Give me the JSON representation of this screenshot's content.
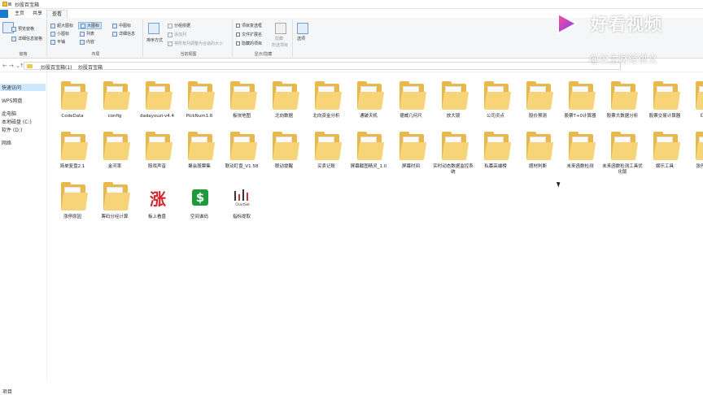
{
  "window": {
    "title": "炒股百宝箱"
  },
  "tabs": {
    "file": "",
    "home": "主页",
    "share": "共享",
    "view": "查看"
  },
  "ribbon": {
    "pane_group": {
      "nav_pane": "",
      "preview_pane": "预览窗格",
      "details_pane": "详细信息窗格",
      "label": "窗格"
    },
    "layout_group": {
      "items": [
        "超大图标",
        "大图标",
        "中图标",
        "小图标",
        "列表",
        "详细信息",
        "平铺",
        "内容"
      ],
      "label": "布局"
    },
    "view_group": {
      "sort": "排序方式",
      "group_by": "分组依据",
      "add_column": "添加列",
      "fit_columns": "将所有列调整为合适的大小",
      "label": "当前视图"
    },
    "showhide_group": {
      "item_checkboxes": "项目复选框",
      "file_extensions": "文件扩展名",
      "hidden_items": "隐藏的项目",
      "hide_selected": "隐藏",
      "hide_selected2": "所选项目",
      "label": "显示/隐藏"
    },
    "options": "选项"
  },
  "address": {
    "crumbs": [
      "炒股百宝箱(1)",
      "炒股百宝箱"
    ],
    "nav_back": "←",
    "nav_forward": "→",
    "nav_recent": "⌄",
    "nav_up": "↑"
  },
  "sidebar": {
    "items": [
      "快速访问",
      "WPS网盘",
      "此电脑",
      "本地磁盘 (C:)",
      "软件 (D:)",
      "网络"
    ]
  },
  "files": [
    {
      "name": "CodeData",
      "kind": "folder",
      "mark": ""
    },
    {
      "name": "config",
      "kind": "folder",
      "mark": ""
    },
    {
      "name": "dadayouzi-v4.4",
      "kind": "folder",
      "mark": "dark"
    },
    {
      "name": "PickNum1.6",
      "kind": "folder",
      "mark": "gray"
    },
    {
      "name": "板块地图",
      "kind": "folder",
      "mark": "gray"
    },
    {
      "name": "北向数据",
      "kind": "folder",
      "mark": ""
    },
    {
      "name": "北向资金分析",
      "kind": "folder",
      "mark": "gray"
    },
    {
      "name": "通破天机",
      "kind": "folder",
      "mark": "gray"
    },
    {
      "name": "德威几何尺",
      "kind": "folder",
      "mark": "gray"
    },
    {
      "name": "放大镜",
      "kind": "folder",
      "mark": "pink"
    },
    {
      "name": "公司灵点",
      "kind": "folder",
      "mark": "gray"
    },
    {
      "name": "股价预测",
      "kind": "folder",
      "mark": "red"
    },
    {
      "name": "股票T+0计算器",
      "kind": "folder",
      "mark": "blue"
    },
    {
      "name": "股票大数据分析",
      "kind": "folder",
      "mark": "teal"
    },
    {
      "name": "股票交易计算器",
      "kind": "folder",
      "mark": "gray"
    },
    {
      "name": "红绿数",
      "kind": "folder",
      "mark": "blue"
    },
    {
      "name": "简单复盘2.1",
      "kind": "folder",
      "mark": "gray"
    },
    {
      "name": "金河率",
      "kind": "folder",
      "mark": "gray"
    },
    {
      "name": "股戏声音",
      "kind": "folder",
      "mark": "teal"
    },
    {
      "name": "聚会股票集",
      "kind": "folder",
      "mark": "gray"
    },
    {
      "name": "联动盯盘_V1.58",
      "kind": "folder",
      "mark": "gray"
    },
    {
      "name": "联动提醒",
      "kind": "folder",
      "mark": "dark"
    },
    {
      "name": "买卖记账",
      "kind": "folder",
      "mark": "red"
    },
    {
      "name": "屏幕截图精灵_1.0",
      "kind": "folder",
      "mark": "blue"
    },
    {
      "name": "屏幕时间",
      "kind": "folder",
      "mark": "red"
    },
    {
      "name": "实时动态数据监控系统",
      "kind": "folder",
      "mark": "red"
    },
    {
      "name": "私募高端榜",
      "kind": "folder",
      "mark": "red"
    },
    {
      "name": "题材判断",
      "kind": "folder",
      "mark": "blue"
    },
    {
      "name": "未来函数检测",
      "kind": "folder",
      "mark": "gray"
    },
    {
      "name": "未来函数检测工具优化版",
      "kind": "folder",
      "mark": "gray"
    },
    {
      "name": "娱乐工具",
      "kind": "folder",
      "mark": "gray"
    },
    {
      "name": "张停辅助工",
      "kind": "folder",
      "mark": "blue"
    },
    {
      "name": "涨停原因",
      "kind": "folder",
      "mark": "gray"
    },
    {
      "name": "筹码分经计算",
      "kind": "folder",
      "mark": "gray"
    },
    {
      "name": "板上看盘",
      "kind": "app",
      "mark": "zhang"
    },
    {
      "name": "空间谁码",
      "kind": "app",
      "mark": "dollar"
    },
    {
      "name": "指标提取",
      "kind": "app",
      "mark": "chart"
    }
  ],
  "app_glyphs": {
    "zhang": "涨",
    "dollar": "$",
    "chart_caption": "ChartSet"
  },
  "status": {
    "count": "项目"
  },
  "watermark": {
    "brand": "好看视频",
    "author": "@公主财经讲义"
  },
  "colors": {
    "folder": "#e8b84a",
    "folder_front": "#f6d477",
    "accent": "#1979ca",
    "selection": "#cce8ff"
  }
}
